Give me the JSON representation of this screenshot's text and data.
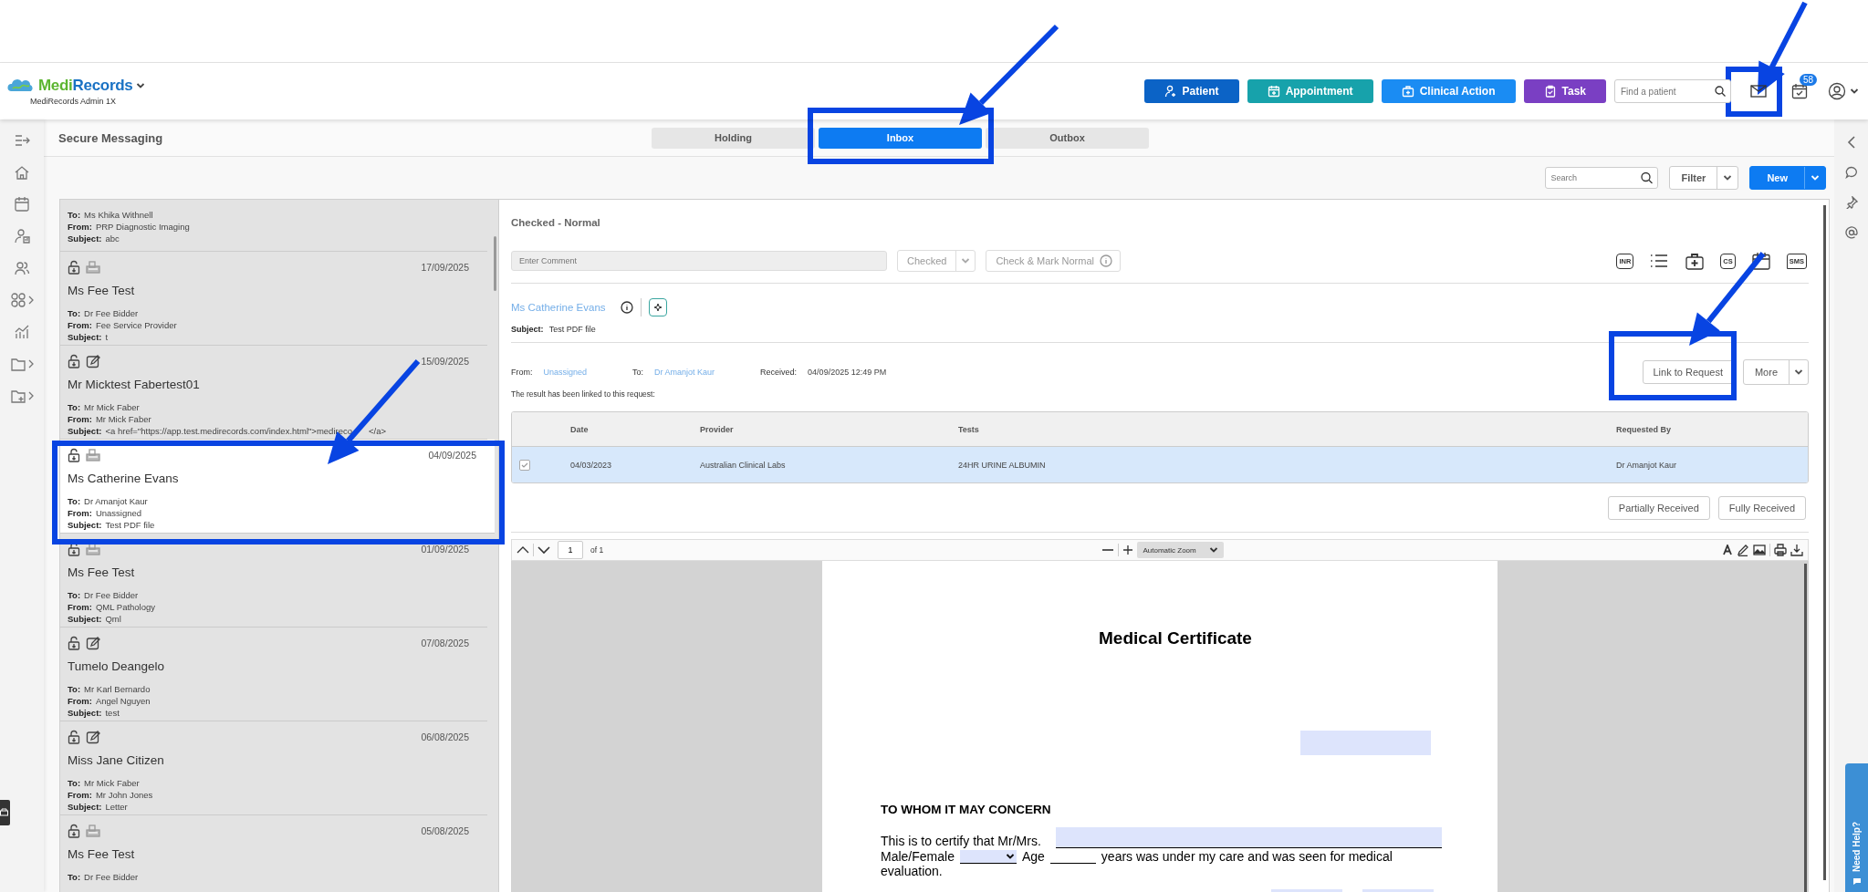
{
  "logo": {
    "first": "Medi",
    "second": "Records"
  },
  "account": "MediRecords Admin 1X",
  "header_buttons": [
    {
      "label": "Patient",
      "color": "#0b63c6"
    },
    {
      "label": "Appointment",
      "color": "#17a2ab"
    },
    {
      "label": "Clinical Action",
      "color": "#1a8cf3"
    },
    {
      "label": "Task",
      "color": "#7a3fc3"
    }
  ],
  "patient_search": {
    "placeholder": "Find a patient"
  },
  "notification_count": "58",
  "page_title": "Secure Messaging",
  "tabs": [
    {
      "label": "Holding",
      "selected": false
    },
    {
      "label": "Inbox",
      "selected": true
    },
    {
      "label": "Outbox",
      "selected": false
    }
  ],
  "toolbar": {
    "search_placeholder": "Search",
    "filter": "Filter",
    "new": "New"
  },
  "messages": [
    {
      "selected": false,
      "fields": [
        {
          "label": "To:",
          "value": "Ms Khika Withnell"
        },
        {
          "label": "From:",
          "value": "PRP Diagnostic Imaging"
        },
        {
          "label": "Subject:",
          "value": "abc"
        }
      ]
    },
    {
      "selected": false,
      "kind": "fax",
      "date": "17/09/2025",
      "name": "Ms Fee Test",
      "fields": [
        {
          "label": "To:",
          "value": "Dr Fee Bidder"
        },
        {
          "label": "From:",
          "value": "Fee Service Provider"
        },
        {
          "label": "Subject:",
          "value": "t"
        }
      ]
    },
    {
      "selected": false,
      "kind": "edit",
      "date": "15/09/2025",
      "name": "Mr Micktest Fabertest01",
      "fields": [
        {
          "label": "To:",
          "value": "Mr Mick Faber"
        },
        {
          "label": "From:",
          "value": "Mr Mick Faber"
        },
        {
          "label": "Subject:",
          "value": "<a href=\"https://app.test.medirecords.com/index.html\">medireco",
          "after": "</a>"
        }
      ]
    },
    {
      "selected": true,
      "kind": "fax",
      "date": "04/09/2025",
      "name": "Ms Catherine Evans",
      "fields": [
        {
          "label": "To:",
          "value": "Dr Amanjot Kaur"
        },
        {
          "label": "From:",
          "value": "Unassigned"
        },
        {
          "label": "Subject:",
          "value": "Test PDF file"
        }
      ]
    },
    {
      "selected": false,
      "kind": "fax",
      "date": "01/09/2025",
      "name": "Ms Fee Test",
      "fields": [
        {
          "label": "To:",
          "value": "Dr Fee Bidder"
        },
        {
          "label": "From:",
          "value": "QML Pathology"
        },
        {
          "label": "Subject:",
          "value": "Qml"
        }
      ]
    },
    {
      "selected": false,
      "kind": "edit",
      "date": "07/08/2025",
      "name": "Tumelo Deangelo",
      "fields": [
        {
          "label": "To:",
          "value": "Mr Karl Bernardo"
        },
        {
          "label": "From:",
          "value": "Angel Nguyen"
        },
        {
          "label": "Subject:",
          "value": "test"
        }
      ]
    },
    {
      "selected": false,
      "kind": "edit",
      "date": "06/08/2025",
      "name": "Miss Jane Citizen",
      "fields": [
        {
          "label": "To:",
          "value": "Mr Mick Faber"
        },
        {
          "label": "From:",
          "value": "Mr John Jones"
        },
        {
          "label": "Subject:",
          "value": "Letter"
        }
      ]
    },
    {
      "selected": false,
      "kind": "fax",
      "date": "05/08/2025",
      "name": "Ms Fee Test",
      "fields": [
        {
          "label": "To:",
          "value": "Dr Fee Bidder"
        }
      ]
    }
  ],
  "detail": {
    "status_title": "Checked - Normal",
    "comment_placeholder": "Enter Comment",
    "status_select": "Checked",
    "mark_normal": "Check & Mark Normal",
    "action_icons": [
      {
        "kind": "badge",
        "label": "INR"
      },
      {
        "kind": "list"
      },
      {
        "kind": "medkit"
      },
      {
        "kind": "badge",
        "label": "CS"
      },
      {
        "kind": "calendar"
      },
      {
        "kind": "chat",
        "label": "SMS"
      }
    ],
    "patient_name": "Ms Catherine Evans",
    "subject": {
      "label": "Subject:",
      "value": "Test PDF file"
    },
    "meta": [
      {
        "label": "From:",
        "value": "Unassigned"
      },
      {
        "label": "To:",
        "value": "Dr Amanjot Kaur"
      },
      {
        "label": "Received:",
        "value": "04/09/2025 12:49 PM"
      }
    ],
    "link_button": "Link to Request",
    "more_button": "More",
    "linked_note": "The result has been linked to this request:",
    "table": {
      "columns": [
        "Date",
        "Provider",
        "Tests",
        "Requested By"
      ],
      "rows": [
        {
          "selected": true,
          "checked": true,
          "cells": [
            "04/03/2023",
            "Australian Clinical Labs",
            "24HR URINE ALBUMIN",
            "Dr Amanjot Kaur"
          ]
        }
      ]
    },
    "receive_buttons": [
      "Partially Received",
      "Fully Received"
    ]
  },
  "pdf": {
    "page": "1",
    "page_count": "of 1",
    "zoom": "Automatic Zoom",
    "document": {
      "title": "Medical Certificate",
      "heading": "TO WHOM IT MAY CONCERN",
      "certify": "This is to certify that Mr/Mrs.",
      "gender": "Male/Female",
      "age": "Age",
      "care": "years was under my care and was seen for medical",
      "evaluation": "evaluation."
    }
  },
  "help": "Need Help?"
}
